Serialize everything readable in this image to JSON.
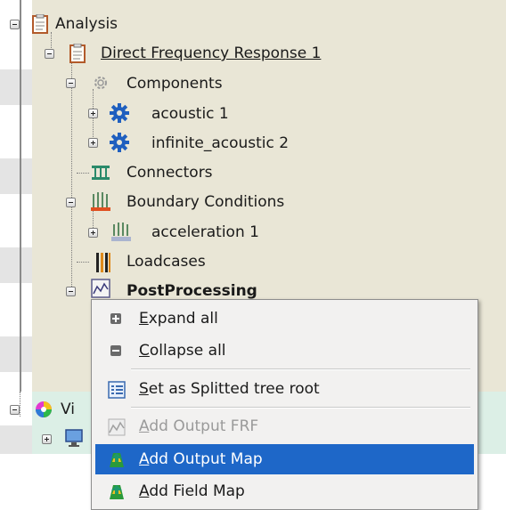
{
  "tree": {
    "analysis": "Analysis",
    "direct_freq": "Direct Frequency Response 1",
    "components": "Components",
    "acoustic": "acoustic 1",
    "infinite_acoustic": "infinite_acoustic 2",
    "connectors": "Connectors",
    "boundary_conditions": "Boundary Conditions",
    "acceleration": "acceleration 1",
    "loadcases": "Loadcases",
    "postprocessing": "PostProcessing",
    "visual_partial": "Vi"
  },
  "context_menu": {
    "expand_all": {
      "accel": "E",
      "rest": "xpand all"
    },
    "collapse_all": {
      "accel": "C",
      "rest": "ollapse all"
    },
    "set_root": {
      "accel": "S",
      "rest": "et as Splitted tree root"
    },
    "add_output_frf": {
      "accel": "A",
      "rest": "dd Output FRF"
    },
    "add_output_map": {
      "accel": "A",
      "rest": "dd Output Map"
    },
    "add_field_map": {
      "accel": "A",
      "rest": "dd Field Map"
    }
  },
  "colors": {
    "tree_bg": "#e9e6d6",
    "visual_bg": "#dcefe6",
    "selection": "#1e67c8",
    "menu_bg": "#f2f1f0"
  }
}
